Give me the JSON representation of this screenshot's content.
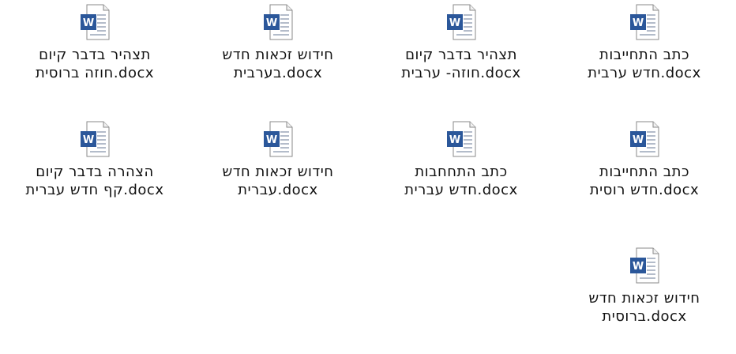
{
  "icon": "word-document-icon",
  "colors": {
    "word_blue": "#2b579a",
    "page_border": "#8a8a8a",
    "text": "#111111",
    "background": "#ffffff"
  },
  "files": [
    {
      "line1": "כתב התחייבות",
      "line2": "חדש ערבית.docx"
    },
    {
      "line1": "תצהיר בדבר קיום",
      "line2": "חוזה- ערבית.docx"
    },
    {
      "line1": "חידוש זכאות חדש",
      "line2": "בערבית.docx"
    },
    {
      "line1": "תצהיר בדבר קיום",
      "line2": "חוזה ברוסית.docx"
    },
    {
      "line1": "כתב התחייבות",
      "line2": "חדש רוסית.docx"
    },
    {
      "line1": "כתב התחחבות",
      "line2": "חדש עברית.docx"
    },
    {
      "line1": "חידוש זכאות חדש",
      "line2": "עברית.docx"
    },
    {
      "line1": "הצהרה בדבר קיום",
      "line2": "קף חדש עברית.docx"
    },
    {
      "line1": "חידוש זכאות חדש",
      "line2": "ברוסית.docx"
    }
  ]
}
